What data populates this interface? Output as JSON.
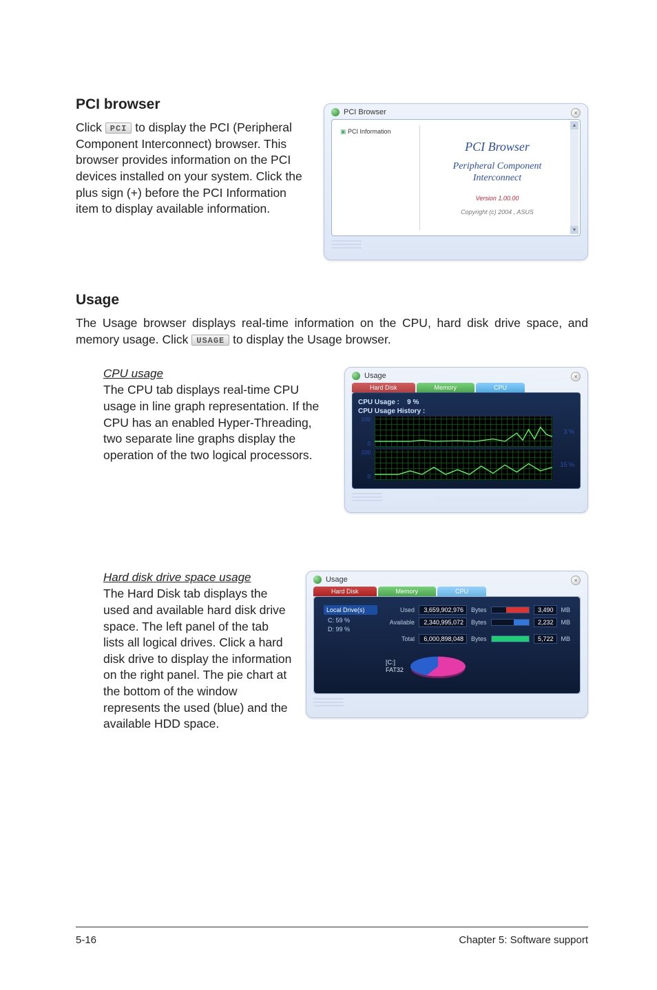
{
  "pci_section": {
    "title": "PCI browser",
    "body_pre": "Click ",
    "btn": "PCI",
    "body_post": " to display the PCI (Peripheral Component Interconnect) browser. This browser provides information on the PCI devices installed on your system. Click the plus sign (+) before the PCI Information item to display available information."
  },
  "pci_window": {
    "title": "PCI Browser",
    "tree_root": "PCI Information",
    "heading": "PCI Browser",
    "sub": "Peripheral Component Interconnect",
    "version": "Version 1.00.00",
    "copyright": "Copyright (c) 2004 ,  ASUS"
  },
  "usage_section": {
    "title": "Usage",
    "body_pre": "The Usage browser displays real-time information on the CPU, hard disk drive space, and memory usage. Click ",
    "btn": "USAGE",
    "body_post": " to display the Usage browser."
  },
  "cpu_block": {
    "subhead": "CPU usage",
    "body": "The CPU tab displays real-time CPU usage in line graph representation. If the CPU has an enabled Hyper-Threading, two separate line graphs display the operation of the two logical processors."
  },
  "cpu_window": {
    "title": "Usage",
    "tabs": {
      "hd": "Hard Disk",
      "mem": "Memory",
      "cpu": "CPU"
    },
    "usage_label": "CPU Usage :",
    "usage_value": "9  %",
    "history_label": "CPU Usage History :",
    "y_top": "100",
    "y_bot": "0",
    "pct1": "3 %",
    "pct2": "15 %"
  },
  "hdd_block": {
    "subhead": "Hard disk drive space usage",
    "body": "The Hard Disk tab displays the used and available hard disk drive space. The left panel of the tab lists all logical drives. Click a hard disk drive to display the information on the right panel. The pie chart at the bottom of the window represents the used (blue) and the available HDD space."
  },
  "hdd_window": {
    "title": "Usage",
    "tabs": {
      "hd": "Hard Disk",
      "mem": "Memory",
      "cpu": "CPU"
    },
    "left_header": "Local Drive(s)",
    "drives": [
      "C:  59 %",
      "D:  99 %"
    ],
    "rows": {
      "used": {
        "label": "Used",
        "bytes": "3,659,902,976",
        "unit": "Bytes",
        "mb": "3,490",
        "mbunit": "MB"
      },
      "avail": {
        "label": "Available",
        "bytes": "2,340,995,072",
        "unit": "Bytes",
        "mb": "2,232",
        "mbunit": "MB"
      },
      "total": {
        "label": "Total",
        "bytes": "6,000,898,048",
        "unit": "Bytes",
        "mb": "5,722",
        "mbunit": "MB"
      }
    },
    "drive_label": "[C:]",
    "fs_label": "FAT32"
  },
  "footer": {
    "left": "5-16",
    "right": "Chapter 5: Software support"
  }
}
